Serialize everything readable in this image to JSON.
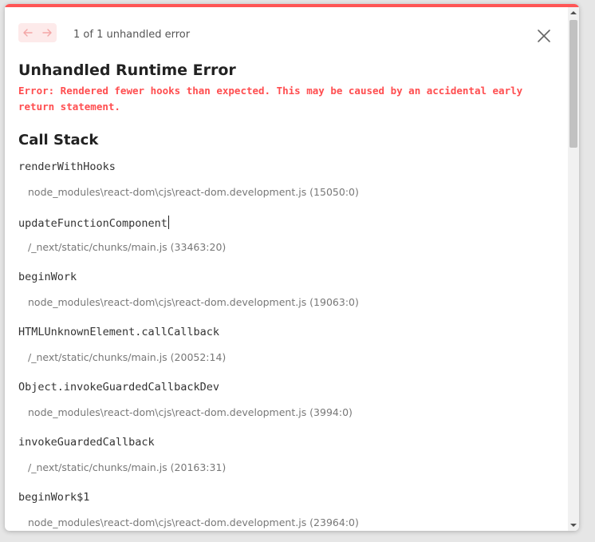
{
  "header": {
    "counter_text": "1 of 1 unhandled error"
  },
  "error": {
    "title": "Unhandled Runtime Error",
    "message": "Error: Rendered fewer hooks than expected. This may be caused by an accidental early return statement."
  },
  "call_stack": {
    "heading": "Call Stack",
    "frames": [
      {
        "fn": "renderWithHooks",
        "location": "node_modules\\react-dom\\cjs\\react-dom.development.js (15050:0)"
      },
      {
        "fn": "updateFunctionComponent",
        "location": "/_next/static/chunks/main.js (33463:20)"
      },
      {
        "fn": "beginWork",
        "location": "node_modules\\react-dom\\cjs\\react-dom.development.js (19063:0)"
      },
      {
        "fn": "HTMLUnknownElement.callCallback",
        "location": "/_next/static/chunks/main.js (20052:14)"
      },
      {
        "fn": "Object.invokeGuardedCallbackDev",
        "location": "node_modules\\react-dom\\cjs\\react-dom.development.js (3994:0)"
      },
      {
        "fn": "invokeGuardedCallback",
        "location": "/_next/static/chunks/main.js (20163:31)"
      },
      {
        "fn": "beginWork$1",
        "location": "node_modules\\react-dom\\cjs\\react-dom.development.js (23964:0)"
      }
    ]
  },
  "colors": {
    "accent": "#ff5555",
    "error_text": "#ff4d4f",
    "nav_bg": "#fdeaea"
  },
  "icons": {
    "prev": "arrow-left-icon",
    "next": "arrow-right-icon",
    "close": "close-icon"
  }
}
